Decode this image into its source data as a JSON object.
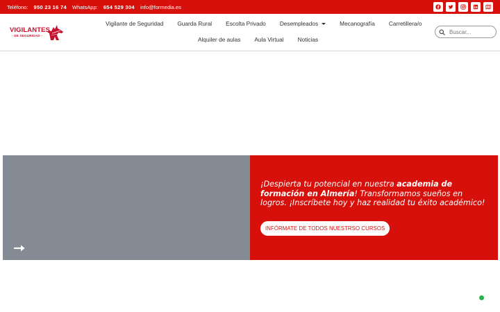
{
  "topbar": {
    "phone_label": "Teléfono:",
    "phone_value": "950 23 16 74",
    "whatsapp_label": "WhatsApp:",
    "whatsapp_value": "654 529 304",
    "email": "info@formedia.es",
    "socials": [
      "facebook-icon",
      "twitter-icon",
      "instagram-icon",
      "linkedin-icon",
      "map-icon"
    ]
  },
  "logo": {
    "line1": "VIGILANTES",
    "line2": "- DE SEGURIDAD -"
  },
  "nav": {
    "items": [
      "Vigilante de Seguridad",
      "Guarda Rural",
      "Escolta Privado",
      "Desempleados",
      "Mecanografía",
      "Carretillera/o",
      "Alquiler de aulas",
      "Aula Virtual",
      "Noticias"
    ]
  },
  "search": {
    "placeholder": "Buscar..."
  },
  "hero": {
    "text_1": "¡Despierta tu potencial en nuestra ",
    "text_bold": "academia de formación en Almería",
    "text_2": "! Transformamos sueños en logros. ¡Inscríbete hoy y haz realidad tu éxito académico!",
    "cta_label": "INFÓRMATE DE TODOS NUESTRSO CURSOS"
  },
  "colors": {
    "brand_red": "#d7100b",
    "hero_gray": "#858b94",
    "status_green": "#2bb24c"
  }
}
